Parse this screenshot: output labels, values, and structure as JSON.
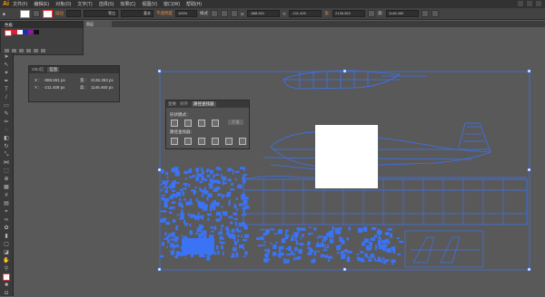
{
  "app": {
    "logo": "Ai"
  },
  "menubar": {
    "items": [
      "文件(F)",
      "编辑(E)",
      "对象(O)",
      "文字(T)",
      "选择(S)",
      "效果(C)",
      "视图(V)",
      "窗口(W)",
      "帮助(H)"
    ]
  },
  "controlbar": {
    "stroke_label": "描边",
    "uniform_label": "等比",
    "basic_label": "基本",
    "opacity_label": "不透明度",
    "opacity_value": "100%",
    "style_label": "样式",
    "x_value": "-888.651",
    "y_value": "-211.409",
    "w_value": "2136.353",
    "h_value": "1146.460"
  },
  "tabs": {
    "active": "图层"
  },
  "swatches_panel": {
    "title": "色板"
  },
  "info_panel": {
    "tabs": [
      "OBJ信",
      "信息"
    ],
    "x_label": "X :",
    "x_value": "-888.651 px",
    "y_label": "Y :",
    "y_value": "-211.409 px",
    "w_label": "宽 :",
    "w_value": "2136.353 px",
    "h_label": "高 :",
    "h_value": "1146.460 px"
  },
  "pathfinder_panel": {
    "tabs": [
      "变换",
      "对齐",
      "路径查找器"
    ],
    "shape_modes_label": "形状模式：",
    "pathfinder_label": "路径查找器：",
    "expand_label": "扩展"
  },
  "colors": {
    "canvas": "#595959",
    "panel": "#484848",
    "path_blue": "#3b73f5",
    "accent_orange": "#e8873a"
  }
}
